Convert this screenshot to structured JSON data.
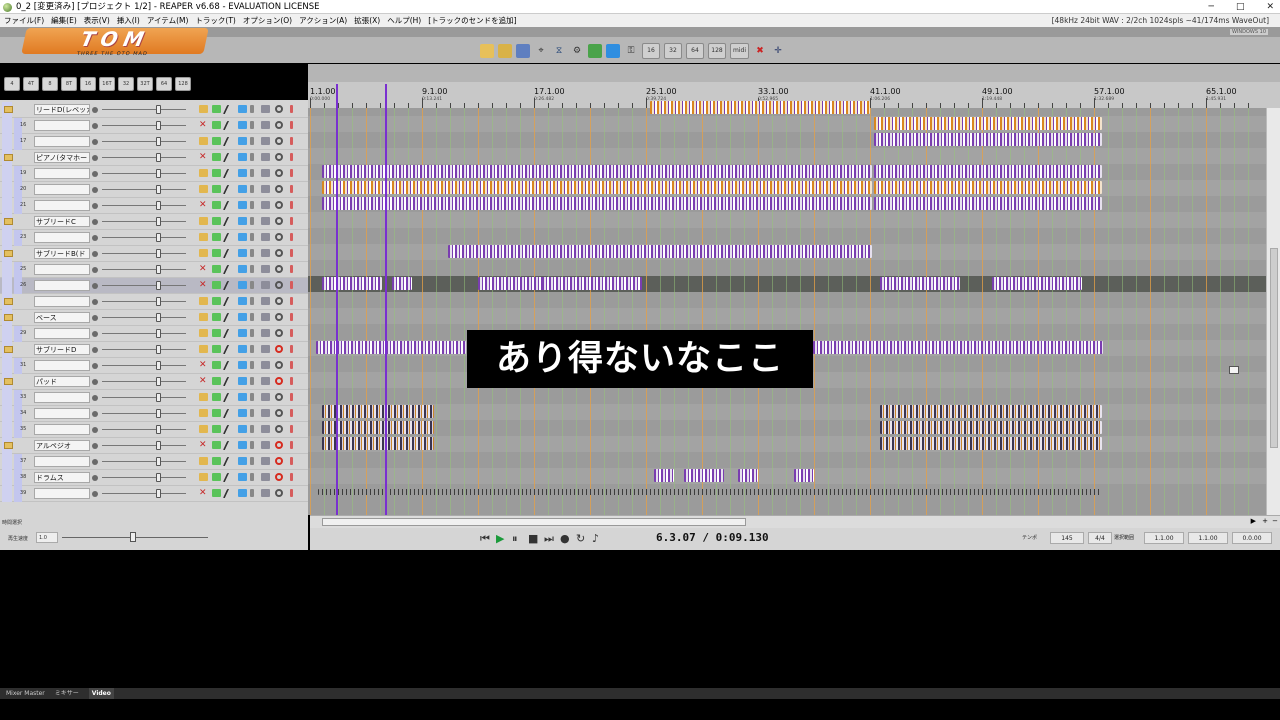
{
  "window": {
    "title": "0_2 [変更済み] [プロジェクト 1/2] - REAPER v6.68 - EVALUATION LICENSE",
    "controls": [
      "─",
      "□",
      "✕"
    ]
  },
  "menu": {
    "items": [
      "ファイル(F)",
      "編集(E)",
      "表示(V)",
      "挿入(I)",
      "アイテム(M)",
      "トラック(T)",
      "オプション(O)",
      "アクション(A)",
      "拡張(X)",
      "ヘルプ(H)",
      "[トラックのセンドを追加]"
    ],
    "status": "[48kHz 24bit WAV : 2/2ch 1024spls ~41/174ms WaveOut]"
  },
  "logo": {
    "text": "TOM",
    "subtitle": "THREE THE OTO MAD"
  },
  "top_right_label": "WINDOWS 10",
  "toolbar": {
    "grid_buttons": [
      "16",
      "32",
      "64",
      "128",
      "midi"
    ]
  },
  "grid_division_buttons": [
    "4",
    "4T",
    "8",
    "8T",
    "16",
    "16T",
    "32",
    "32T",
    "64",
    "128"
  ],
  "tracks": [
    {
      "num": "",
      "name": "リードD(レベッカ",
      "folder": true
    },
    {
      "num": "16",
      "name": "",
      "folder": false
    },
    {
      "num": "17",
      "name": "",
      "folder": false
    },
    {
      "num": "",
      "name": "ピアノ(タマホー",
      "folder": true
    },
    {
      "num": "19",
      "name": "",
      "folder": false
    },
    {
      "num": "20",
      "name": "",
      "folder": false
    },
    {
      "num": "21",
      "name": "",
      "folder": false
    },
    {
      "num": "",
      "name": "サブリードC",
      "folder": true
    },
    {
      "num": "23",
      "name": "",
      "folder": false
    },
    {
      "num": "",
      "name": "サブリードB(ド",
      "folder": true
    },
    {
      "num": "25",
      "name": "",
      "folder": false
    },
    {
      "num": "26",
      "name": "",
      "folder": false,
      "selected": true
    },
    {
      "num": "",
      "name": "",
      "folder": true
    },
    {
      "num": "",
      "name": "ベース",
      "folder": true
    },
    {
      "num": "29",
      "name": "",
      "folder": false
    },
    {
      "num": "",
      "name": "サブリードD",
      "folder": true
    },
    {
      "num": "31",
      "name": "",
      "folder": false
    },
    {
      "num": "",
      "name": "パッド",
      "folder": true
    },
    {
      "num": "33",
      "name": "",
      "folder": false
    },
    {
      "num": "34",
      "name": "",
      "folder": false
    },
    {
      "num": "35",
      "name": "",
      "folder": false
    },
    {
      "num": "",
      "name": "アルペジオ",
      "folder": true
    },
    {
      "num": "37",
      "name": "",
      "folder": false
    },
    {
      "num": "38",
      "name": "ドラムス",
      "folder": false
    },
    {
      "num": "39",
      "name": "",
      "folder": false
    }
  ],
  "tcp_footer": {
    "label": "時間選択",
    "playrate_label": "再生速度",
    "playrate_value": "1.0"
  },
  "ruler": {
    "markers": [
      {
        "bar": "1.1.00",
        "time": "0:00.000"
      },
      {
        "bar": "9.1.00",
        "time": "0:13.241"
      },
      {
        "bar": "17.1.00",
        "time": "0:26.482"
      },
      {
        "bar": "25.1.00",
        "time": "0:39.724"
      },
      {
        "bar": "33.1.00",
        "time": "0:52.965"
      },
      {
        "bar": "41.1.00",
        "time": "1:06.206"
      },
      {
        "bar": "49.1.00",
        "time": "1:19.448"
      },
      {
        "bar": "57.1.00",
        "time": "1:32.689"
      },
      {
        "bar": "65.1.00",
        "time": "1:45.931"
      }
    ]
  },
  "transport": {
    "position": "6.3.07 / 0:09.130",
    "bpm_label": "テンポ",
    "bpm": "145",
    "sig": "4/4",
    "sel_label": "選択範囲",
    "sel_start": "1.1.00",
    "sel_end": "1.1.00",
    "sel_len": "0.0.00"
  },
  "caption": "あり得ないなここ",
  "bottom_tabs": [
    "Mixer Master",
    "ミキサー",
    "Video"
  ],
  "colors": {
    "accent_purple": "#7a30d0",
    "item_orange": "#d9861f",
    "panel_grey": "#d5d5d5"
  }
}
